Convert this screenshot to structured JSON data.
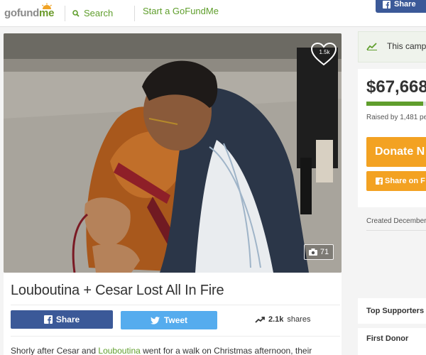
{
  "header": {
    "logo_go": "go",
    "logo_fund": "fund",
    "logo_me": "me",
    "search_label": "Search",
    "start_label": "Start a GoFundMe",
    "share_label": "Share"
  },
  "photo": {
    "likes": "1.5k",
    "photo_count": "71"
  },
  "campaign": {
    "title": "Louboutina + Cesar Lost All In Fire",
    "fb_share_label": "Share",
    "tweet_label": "Tweet",
    "share_count": "2.1k",
    "shares_word": "shares",
    "story_before": "Shorly after Cesar and ",
    "story_name": "Louboutina",
    "story_after": " went for a walk on Christmas afternoon, their"
  },
  "sidebar": {
    "trending_text": "This camp",
    "amount": "$67,668",
    "raised_text": "Raised by 1,481 pe",
    "progress_fraction": 0.95,
    "donate_label": "Donate N",
    "fb_share_label": "Share on F",
    "created_text": "Created December",
    "top_supporters": "Top Supporters",
    "first_donor": "First Donor"
  },
  "colors": {
    "brand_green": "#5f9e2c",
    "facebook_blue": "#3b5998",
    "twitter_blue": "#55acee",
    "donate_orange": "#f3a222"
  },
  "icons": [
    "sun-logo-icon",
    "search-icon",
    "facebook-icon",
    "heart-icon",
    "camera-icon",
    "twitter-icon",
    "trending-up-icon"
  ]
}
